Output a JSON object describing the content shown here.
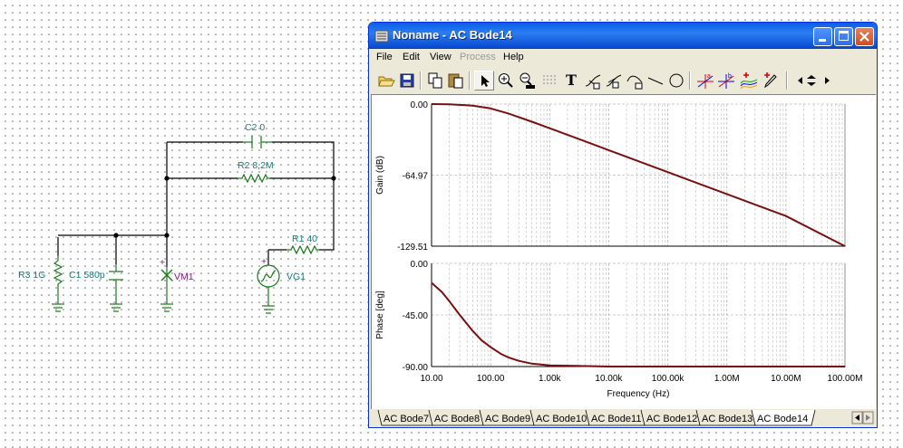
{
  "schematic": {
    "labels": {
      "c2": "C2 0",
      "r2": "R2 8,2M",
      "r1": "R1 40",
      "r3": "R3 1G",
      "c1": "C1 580p",
      "vm1": "VM1",
      "vg1": "VG1",
      "vm1_plus": "+",
      "vm1_minus": "-",
      "vg1_plus": "+"
    }
  },
  "window": {
    "title": "Noname - AC Bode14",
    "menu": [
      "File",
      "Edit",
      "View",
      "Process",
      "Help"
    ],
    "toolbar_text_tool": "T"
  },
  "tabs": [
    "AC Bode7",
    "AC Bode8",
    "AC Bode9",
    "AC Bode10",
    "AC Bode11",
    "AC Bode12",
    "AC Bode13",
    "AC Bode14"
  ],
  "colors": {
    "trace": "#7a0f0f",
    "grid": "#bdbdbd",
    "titlebar": "#0a5fe8"
  },
  "chart_data": [
    {
      "type": "line",
      "ylabel": "Gain (dB)",
      "xlabel": "",
      "x_scale": "log",
      "xlim": [
        10,
        100000000
      ],
      "ylim": [
        -129.51,
        0.0
      ],
      "yticks": [
        "0.00",
        "-64.97",
        "-129.51"
      ],
      "grid": true,
      "series": [
        {
          "x": [
            10,
            20,
            50,
            100,
            200,
            500,
            1000,
            2000,
            5000,
            10000,
            100000,
            1000000,
            10000000,
            100000000
          ],
          "values": [
            0.0,
            -0.2,
            -1.4,
            -4.0,
            -8.6,
            -16.1,
            -22.0,
            -28.0,
            -36.0,
            -42.0,
            -62.0,
            -82.0,
            -102.0,
            -129.5
          ]
        }
      ]
    },
    {
      "type": "line",
      "ylabel": "Phase [deg]",
      "xlabel": "Frequency (Hz)",
      "x_scale": "log",
      "xlim": [
        10,
        100000000
      ],
      "ylim": [
        -90.0,
        0.0
      ],
      "yticks": [
        "0.00",
        "-45.00",
        "-90.00"
      ],
      "xticks": [
        "10.00",
        "100.00",
        "1.00k",
        "10.00k",
        "100.00k",
        "1.00M",
        "10.00M",
        "100.00M"
      ],
      "grid": true,
      "series": [
        {
          "x": [
            10,
            15,
            20,
            30,
            50,
            70,
            100,
            150,
            200,
            300,
            500,
            1000,
            10000,
            100000000
          ],
          "values": [
            -17,
            -25,
            -33,
            -45,
            -59,
            -67,
            -73,
            -79,
            -82,
            -85,
            -87.5,
            -89,
            -90,
            -90
          ]
        }
      ]
    }
  ]
}
